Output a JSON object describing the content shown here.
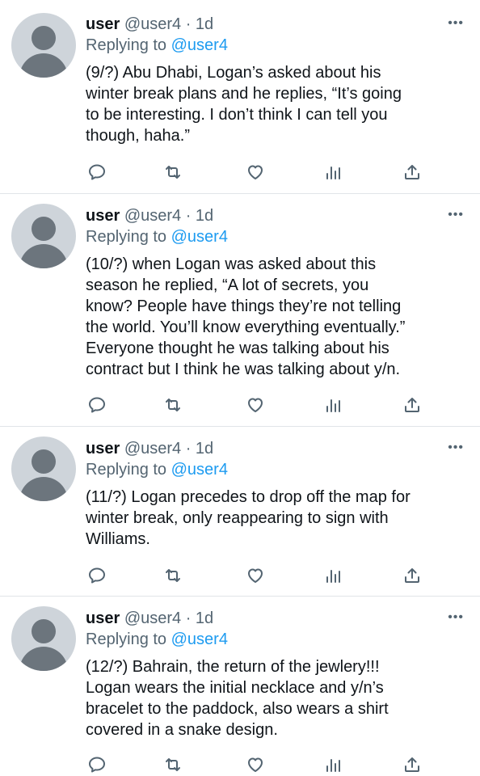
{
  "tweets": [
    {
      "name": "user",
      "handle": "@user4 · 1d",
      "more": "•••",
      "reply_prefix": "Replying to ",
      "reply_handle": "@user4",
      "text": "(9/?) Abu Dhabi, Logan’s asked about his\nwinter break plans and he replies, “It’s going\nto be interesting. I don’t think I can tell you\nthough, haha.”"
    },
    {
      "name": "user",
      "handle": "@user4 · 1d",
      "more": "•••",
      "reply_prefix": "Replying to ",
      "reply_handle": "@user4",
      "text": "(10/?) when Logan was asked about this\nseason he replied, “A lot of secrets, you\nknow? People have things they’re not telling\nthe world. You’ll know everything eventually.”\nEveryone thought he was talking about his\ncontract but I think he was talking about y/n."
    },
    {
      "name": "user",
      "handle": "@user4 · 1d",
      "more": "•••",
      "reply_prefix": "Replying to ",
      "reply_handle": "@user4",
      "text": "(11/?) Logan precedes to drop off the map for\nwinter break, only reappearing to sign with\nWilliams."
    },
    {
      "name": "user",
      "handle": "@user4 · 1d",
      "more": "•••",
      "reply_prefix": "Replying to ",
      "reply_handle": "@user4",
      "text": "(12/?) Bahrain, the return of the jewlery!!!\nLogan wears the initial necklace and y/n’s\nbracelet to the paddock, also wears a shirt\ncovered in a snake design."
    }
  ],
  "icons": [
    "reply-icon",
    "retweet-icon",
    "like-icon",
    "analytics-icon",
    "share-icon"
  ],
  "colors": {
    "link": "#1d9bf0",
    "secondary": "#536471",
    "avatar_bg": "#ced4da",
    "avatar_fg": "#6c757d"
  }
}
